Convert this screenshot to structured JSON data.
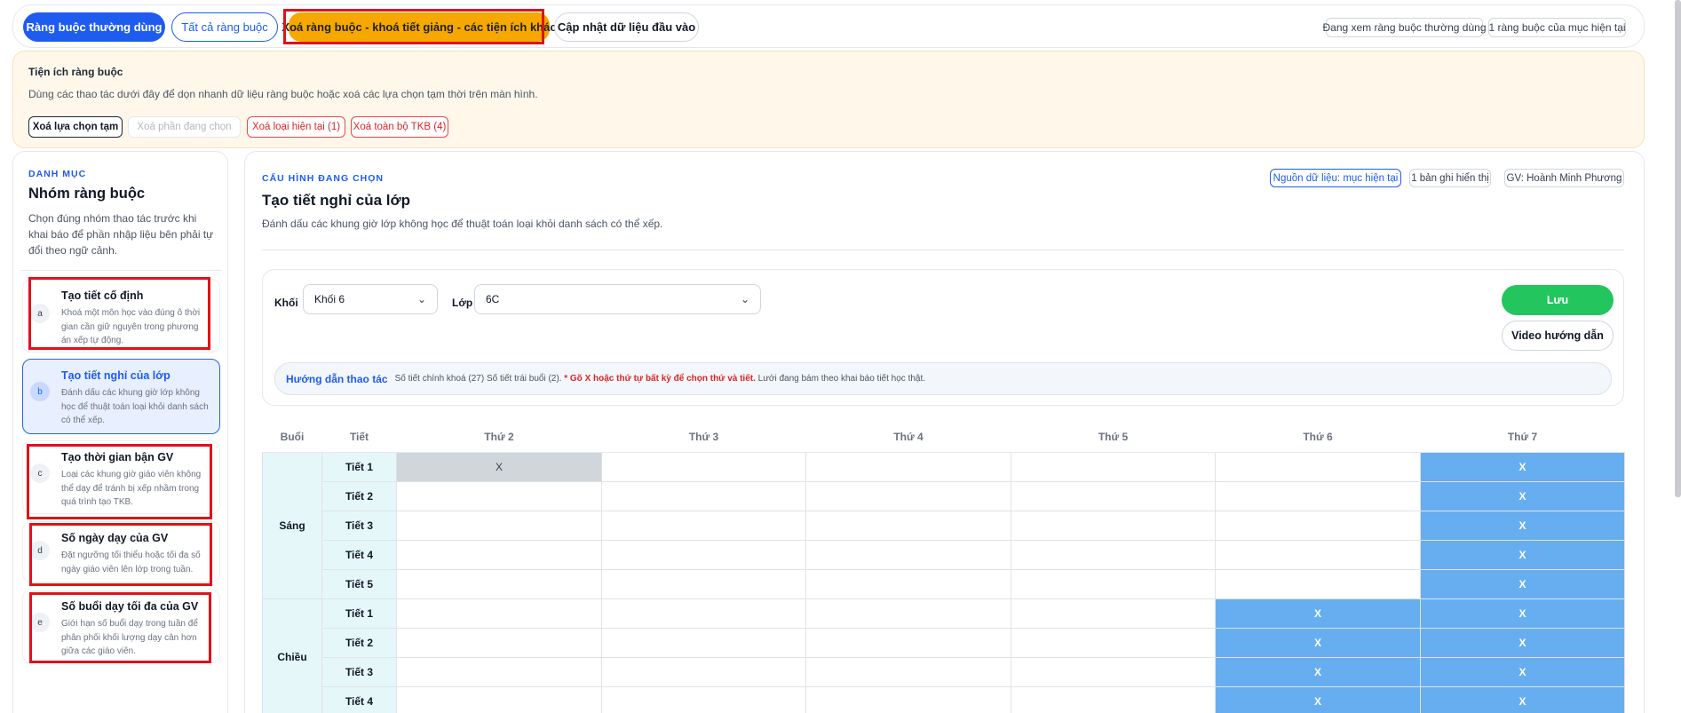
{
  "topbar": {
    "tabs": [
      "Ràng buộc thường dùng",
      "Tất cả ràng buộc",
      "Xoá ràng buộc - khoá tiết giảng - các tiện ích khác",
      "Cập nhật dữ liệu đầu vào"
    ],
    "status_pills": [
      "Đang xem ràng buộc thường dùng",
      "1 ràng buộc của mục hiện tại"
    ]
  },
  "utility": {
    "title": "Tiện ích ràng buộc",
    "description": "Dùng các thao tác dưới đây để dọn nhanh dữ liệu ràng buộc hoặc xoá các lựa chọn tạm thời trên màn hình.",
    "buttons": [
      "Xoá lựa chọn tạm",
      "Xoá phần đang chọn",
      "Xoá loại hiện tại (1)",
      "Xoá toàn bộ TKB (4)"
    ]
  },
  "sidebar": {
    "eyebrow": "DANH MỤC",
    "heading": "Nhóm ràng buộc",
    "description": "Chọn đúng nhóm thao tác trước khi khai báo để phần nhập liệu bên phải tự đổi theo ngữ cảnh.",
    "items": [
      {
        "badge": "a",
        "title": "Tạo tiết cố định",
        "description": "Khoá một môn học vào đúng ô thời gian cần giữ nguyên trong phương án xếp tự động."
      },
      {
        "badge": "b",
        "title": "Tạo tiết nghỉ của lớp",
        "description": "Đánh dấu các khung giờ lớp không học để thuật toán loại khỏi danh sách có thể xếp."
      },
      {
        "badge": "c",
        "title": "Tạo thời gian bận GV",
        "description": "Loại các khung giờ giáo viên không thể dạy để tránh bị xếp nhầm trong quá trình tạo TKB."
      },
      {
        "badge": "d",
        "title": "Số ngày dạy của GV",
        "description": "Đặt ngưỡng tối thiểu hoặc tối đa số ngày giáo viên lên lớp trong tuần."
      },
      {
        "badge": "e",
        "title": "Số buổi dạy tối đa của GV",
        "description": "Giới hạn số buổi dạy trong tuần để phân phối khối lượng dạy cân hơn giữa các giáo viên."
      }
    ]
  },
  "main": {
    "eyebrow": "CẤU HÌNH ĐANG CHỌN",
    "heading": "Tạo tiết nghỉ của lớp",
    "description": "Đánh dấu các khung giờ lớp không học để thuật toán loại khỏi danh sách có thể xếp.",
    "pills": [
      "Nguồn dữ liệu: mục hiện tại",
      "1 bản ghi hiển thị",
      "GV: Hoành Minh Phương"
    ],
    "khoi_label": "Khối",
    "khoi_value": "Khối 6",
    "lop_label": "Lớp",
    "lop_value": "6C",
    "save_label": "Lưu",
    "video_label": "Video hướng dẫn",
    "guide": {
      "title": "Hướng dẫn thao tác",
      "stats": "Số tiết chính khoá (27) Số tiết trái buổi (2).",
      "highlight": "* Gõ X hoặc thứ tự bất kỳ để chọn thứ và tiết.",
      "tail": "Lưới đang bám theo khai báo tiết học thật."
    }
  },
  "grid": {
    "headers": [
      "Buổi",
      "Tiết",
      "Thứ 2",
      "Thứ 3",
      "Thứ 4",
      "Thứ 5",
      "Thứ 6",
      "Thứ 7"
    ],
    "sessions": [
      {
        "name": "Sáng",
        "rows": [
          {
            "period": "Tiết 1",
            "cells": [
              "X",
              "",
              "",
              "",
              "",
              "X"
            ],
            "styles": [
              "gray",
              "",
              "",
              "",
              "",
              "blue"
            ]
          },
          {
            "period": "Tiết 2",
            "cells": [
              "",
              "",
              "",
              "",
              "",
              "X"
            ],
            "styles": [
              "",
              "",
              "",
              "",
              "",
              "blue"
            ]
          },
          {
            "period": "Tiết 3",
            "cells": [
              "",
              "",
              "",
              "",
              "",
              "X"
            ],
            "styles": [
              "",
              "",
              "",
              "",
              "",
              "blue"
            ]
          },
          {
            "period": "Tiết 4",
            "cells": [
              "",
              "",
              "",
              "",
              "",
              "X"
            ],
            "styles": [
              "",
              "",
              "",
              "",
              "",
              "blue"
            ]
          },
          {
            "period": "Tiết 5",
            "cells": [
              "",
              "",
              "",
              "",
              "",
              "X"
            ],
            "styles": [
              "",
              "",
              "",
              "",
              "",
              "blue"
            ]
          }
        ]
      },
      {
        "name": "Chiều",
        "rows": [
          {
            "period": "Tiết 1",
            "cells": [
              "",
              "",
              "",
              "",
              "X",
              "X"
            ],
            "styles": [
              "",
              "",
              "",
              "",
              "blue",
              "blue"
            ]
          },
          {
            "period": "Tiết 2",
            "cells": [
              "",
              "",
              "",
              "",
              "X",
              "X"
            ],
            "styles": [
              "",
              "",
              "",
              "",
              "blue",
              "blue"
            ]
          },
          {
            "period": "Tiết 3",
            "cells": [
              "",
              "",
              "",
              "",
              "X",
              "X"
            ],
            "styles": [
              "",
              "",
              "",
              "",
              "blue",
              "blue"
            ]
          },
          {
            "period": "Tiết 4",
            "cells": [
              "",
              "",
              "",
              "",
              "X",
              "X"
            ],
            "styles": [
              "",
              "",
              "",
              "",
              "blue",
              "blue"
            ]
          }
        ]
      }
    ]
  },
  "colors": {
    "primary": "#1e5cf0",
    "orange": "#f6a800",
    "highlight_border": "#e3101a",
    "save_green": "#22c55e",
    "selected_cell_blue": "#67aef0",
    "selected_cell_gray": "#d1d6db"
  }
}
